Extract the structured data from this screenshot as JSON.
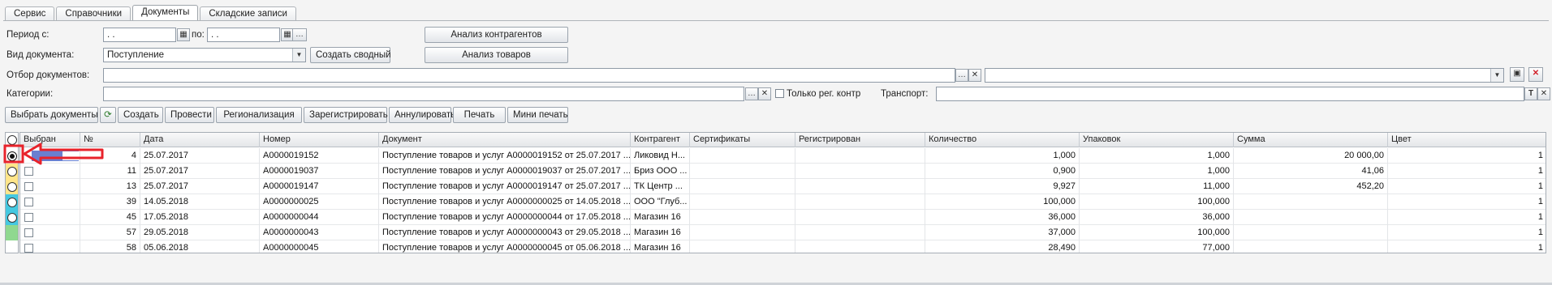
{
  "tabs": [
    "Сервис",
    "Справочники",
    "Документы",
    "Складские записи"
  ],
  "active_tab": 2,
  "filters": {
    "period_from_label": "Период с:",
    "period_from_value": " .  .",
    "period_to_label": "по:",
    "period_to_value": " .  .",
    "doc_type_label": "Вид документа:",
    "doc_type_value": "Поступление",
    "create_summary_button": "Создать сводный",
    "contractors_analysis_button": "Анализ контрагентов",
    "goods_analysis_button": "Анализ товаров",
    "doc_filter_label": "Отбор документов:",
    "categories_label": "Категории:",
    "only_reg_label": "Только рег. контр",
    "transport_label": "Транспорт:"
  },
  "toolbar": {
    "select_docs": "Выбрать документы",
    "create": "Создать",
    "post": "Провести",
    "regionalization": "Регионализация",
    "register": "Зарегистрировать",
    "cancel": "Аннулировать",
    "print": "Печать",
    "mini_print": "Мини печать"
  },
  "columns": [
    "Выбран",
    "№",
    "Дата",
    "Номер",
    "Документ",
    "Контрагент",
    "Сертификаты",
    "Регистрирован",
    "Количество",
    "Упаковок",
    "Сумма",
    "Цвет"
  ],
  "rows": [
    {
      "num": "4",
      "date": "25.07.2017",
      "number": "А0000019152",
      "doc": "Поступление товаров и услуг А0000019152 от 25.07.2017 ...",
      "contractor": "Ликовид Н...",
      "qty": "1,000",
      "packs": "1,000",
      "sum": "20 000,00",
      "color": "1"
    },
    {
      "num": "11",
      "date": "25.07.2017",
      "number": "А0000019037",
      "doc": "Поступление товаров и услуг А0000019037 от 25.07.2017 ...",
      "contractor": "Бриз ООО ...",
      "qty": "0,900",
      "packs": "1,000",
      "sum": "41,06",
      "color": "1"
    },
    {
      "num": "13",
      "date": "25.07.2017",
      "number": "А0000019147",
      "doc": "Поступление товаров и услуг А0000019147 от 25.07.2017 ...",
      "contractor": "ТК Центр ...",
      "qty": "9,927",
      "packs": "11,000",
      "sum": "452,20",
      "color": "1"
    },
    {
      "num": "39",
      "date": "14.05.2018",
      "number": "А0000000025",
      "doc": "Поступление товаров и услуг А0000000025 от 14.05.2018 ...",
      "contractor": "ООО \"Глуб...",
      "qty": "100,000",
      "packs": "100,000",
      "sum": "",
      "color": "1"
    },
    {
      "num": "45",
      "date": "17.05.2018",
      "number": "А0000000044",
      "doc": "Поступление товаров и услуг А0000000044 от 17.05.2018 ...",
      "contractor": "Магазин 16",
      "qty": "36,000",
      "packs": "36,000",
      "sum": "",
      "color": "1"
    },
    {
      "num": "57",
      "date": "29.05.2018",
      "number": "А0000000043",
      "doc": "Поступление товаров и услуг А0000000043 от 29.05.2018 ...",
      "contractor": "Магазин 16",
      "qty": "37,000",
      "packs": "100,000",
      "sum": "",
      "color": "1"
    },
    {
      "num": "58",
      "date": "05.06.2018",
      "number": "А0000000045",
      "doc": "Поступление товаров и услуг А0000000045 от 05.06.2018 ...",
      "contractor": "Магазин 16",
      "qty": "28,490",
      "packs": "77,000",
      "sum": "",
      "color": "1"
    }
  ],
  "row_colors": [
    "#ffffff",
    "#ffe58a",
    "#ffe58a",
    "#45c8e0",
    "#45c8e0",
    "#8fd88f",
    "#ffffff"
  ],
  "accent_colors": {
    "annotation_arrow": "#e8232b",
    "selection": "#6a7fd0"
  }
}
